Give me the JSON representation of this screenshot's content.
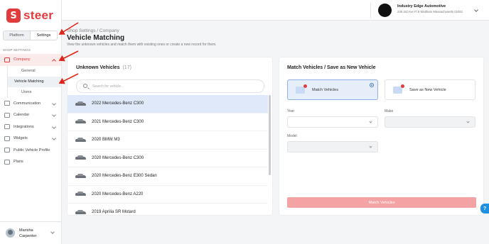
{
  "brand": {
    "name": "steer",
    "color": "#e23b3b"
  },
  "segment": {
    "platform": "Platform",
    "settings": "Settings"
  },
  "sidebar": {
    "section_label": "SHOP SETTINGS",
    "company": "Company",
    "company_items": [
      "General",
      "Vehicle Matching",
      "Users"
    ],
    "items": [
      {
        "label": "Communication",
        "icon": "chat-icon"
      },
      {
        "label": "Calendar",
        "icon": "calendar-icon"
      },
      {
        "label": "Integrations",
        "icon": "integrations-icon"
      },
      {
        "label": "Widgets",
        "icon": "widgets-icon"
      },
      {
        "label": "Public Vehicle Profile",
        "icon": "car-icon"
      },
      {
        "label": "Plans",
        "icon": "plans-icon"
      }
    ],
    "user": {
      "first": "Marisha",
      "last": "Carpenter"
    }
  },
  "topbar": {
    "shop_name": "Industry Edge Automotive",
    "shop_address": "230 3rd Ave Fl 5 Waltham Massachusetts 02451"
  },
  "page": {
    "breadcrumb": "Shop Settings / Company",
    "title": "Vehicle Matching",
    "subtitle": "View the unknown vehicles and match them with existing ones or create a new record for them."
  },
  "unknown": {
    "title": "Unknown Vehicles",
    "count": "(17)",
    "search_placeholder": "Search for vehicle...",
    "vehicles": [
      "2022 Mercedes-Benz C300",
      "2021 Mercedes-Benz C300",
      "2020 BMW M3",
      "2020 Mercedes-Benz C300",
      "2020 Mercedes-Benz E300 Sedan",
      "2020 Mercedes-Benz A220",
      "2019 Aprilia SR Motard"
    ]
  },
  "match": {
    "title": "Match Vehicles / Save as New Vehicle",
    "option_match": "Match Vehicles",
    "option_new": "Save as New Vehicle",
    "year_label": "Year",
    "make_label": "Make",
    "model_label": "Model",
    "button": "Match Vehicles"
  },
  "help": "?"
}
